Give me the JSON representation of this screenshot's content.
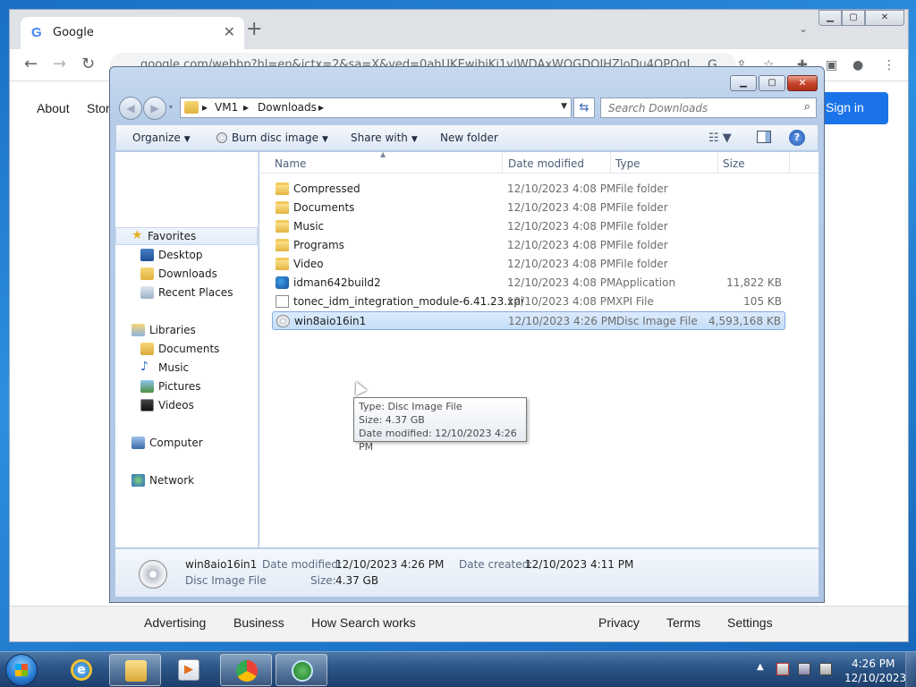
{
  "chrome": {
    "tab_title": "Google",
    "tab_favicon": "G",
    "url": "google.com/webhp?hl=en&ictx=2&sa=X&ved=0ahUKEwjbiKj1vIWDAxWOGDOIHZloDu4QPQgI",
    "icons": {
      "back": "arrow-left-icon",
      "forward": "arrow-right-icon",
      "reload": "reload-icon",
      "lock": "lock-icon"
    }
  },
  "google": {
    "about": "About",
    "store": "Store",
    "sign_in": "Sign in",
    "footer": [
      "Advertising",
      "Business",
      "How Search works",
      "Privacy",
      "Terms",
      "Settings"
    ]
  },
  "explorer": {
    "breadcrumb": [
      "VM1",
      "Downloads"
    ],
    "search_placeholder": "Search Downloads",
    "commands": {
      "organize": "Organize",
      "burn": "Burn disc image",
      "share": "Share with",
      "new_folder": "New folder"
    },
    "nav": {
      "favorites": "Favorites",
      "favorites_items": [
        "Desktop",
        "Downloads",
        "Recent Places"
      ],
      "libraries": "Libraries",
      "libraries_items": [
        "Documents",
        "Music",
        "Pictures",
        "Videos"
      ],
      "computer": "Computer",
      "network": "Network"
    },
    "columns": {
      "name": "Name",
      "date": "Date modified",
      "type": "Type",
      "size": "Size"
    },
    "files": [
      {
        "name": "Compressed",
        "date": "12/10/2023 4:08 PM",
        "type": "File folder",
        "size": "",
        "icon": "folder-icon"
      },
      {
        "name": "Documents",
        "date": "12/10/2023 4:08 PM",
        "type": "File folder",
        "size": "",
        "icon": "folder-icon"
      },
      {
        "name": "Music",
        "date": "12/10/2023 4:08 PM",
        "type": "File folder",
        "size": "",
        "icon": "folder-icon"
      },
      {
        "name": "Programs",
        "date": "12/10/2023 4:08 PM",
        "type": "File folder",
        "size": "",
        "icon": "folder-icon"
      },
      {
        "name": "Video",
        "date": "12/10/2023 4:08 PM",
        "type": "File folder",
        "size": "",
        "icon": "folder-icon"
      },
      {
        "name": "idman642build2",
        "date": "12/10/2023 4:08 PM",
        "type": "Application",
        "size": "11,822 KB",
        "icon": "app-icon"
      },
      {
        "name": "tonec_idm_integration_module-6.41.23.xpi",
        "date": "12/10/2023 4:08 PM",
        "type": "XPI File",
        "size": "105 KB",
        "icon": "document-icon"
      },
      {
        "name": "win8aio16in1",
        "date": "12/10/2023 4:26 PM",
        "type": "Disc Image File",
        "size": "4,593,168 KB",
        "icon": "disc-image-icon"
      }
    ],
    "tooltip": {
      "type": "Type: Disc Image File",
      "size": "Size: 4.37 GB",
      "modified": "Date modified: 12/10/2023 4:26 PM"
    },
    "details": {
      "name": "win8aio16in1",
      "type": "Disc Image File",
      "modified_label": "Date modified:",
      "modified_value": "12/10/2023 4:26 PM",
      "created_label": "Date created:",
      "created_value": "12/10/2023 4:11 PM",
      "size_label": "Size:",
      "size_value": "4.37 GB"
    }
  },
  "taskbar": {
    "time": "4:26 PM",
    "date": "12/10/2023",
    "pinned": [
      "internet-explorer-icon",
      "windows-explorer-icon",
      "media-player-icon",
      "chrome-icon",
      "internet-download-manager-icon"
    ]
  },
  "colors": {
    "accent": "#1a73e8",
    "selection": "#c4ddf8",
    "taskbar": "#2b5486"
  }
}
